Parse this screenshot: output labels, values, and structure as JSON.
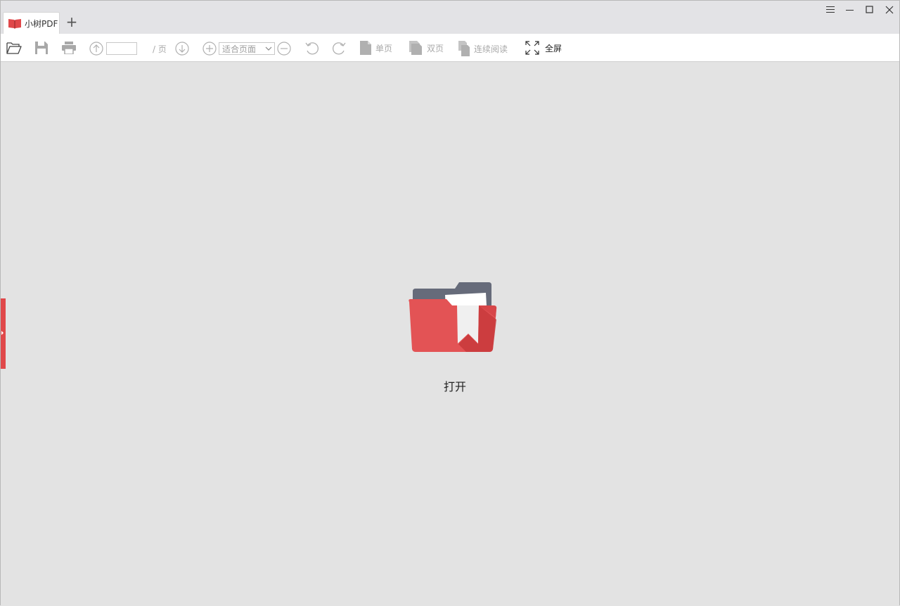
{
  "app": {
    "tab_title": "小树PDF",
    "new_tab": "+"
  },
  "window_controls": [
    "menu-icon",
    "minimize-icon",
    "maximize-icon",
    "close-icon"
  ],
  "toolbar": {
    "page_input_value": "",
    "page_separator": "/ 页",
    "zoom_value": "适合页面",
    "single_page": "单页",
    "double_page": "双页",
    "continuous": "连续阅读",
    "fullscreen": "全屏"
  },
  "main": {
    "open_label": "打开"
  },
  "colors": {
    "accent": "#e0484a",
    "folder_back": "#666b7a",
    "toolbar_disabled": "#a9a9a9",
    "background": "#e3e3e3"
  }
}
